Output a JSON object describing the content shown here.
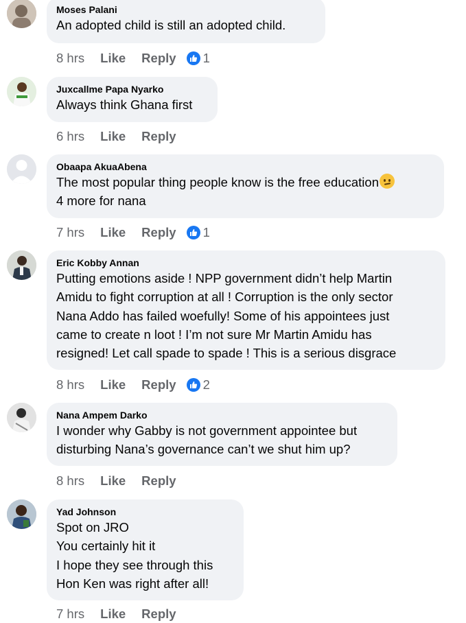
{
  "comments": [
    {
      "author": "Moses Palani",
      "text": "An adopted child is still an adopted child.",
      "time": "8 hrs",
      "like_label": "Like",
      "reply_label": "Reply",
      "reactions": "1",
      "avatar": "user-photo"
    },
    {
      "author": "Juxcallme Papa Nyarko",
      "text": "Always think Ghana first",
      "time": "6 hrs",
      "like_label": "Like",
      "reply_label": "Reply",
      "reactions": null,
      "avatar": "user-photo"
    },
    {
      "author": "Obaapa AkuaAbena",
      "text_line1": "The most popular thing people know is the free education",
      "text_line2": "4 more for nana",
      "emoji": "face-with-raised-eyebrow",
      "time": "7 hrs",
      "like_label": "Like",
      "reply_label": "Reply",
      "reactions": "1",
      "avatar": "default-silhouette"
    },
    {
      "author": "Eric Kobby Annan",
      "text": "Putting emotions aside ! NPP government didn’t help Martin\nAmidu to fight corruption at all ! Corruption is the only sector\nNana Addo has failed woefully! Some of his appointees just\ncame to create n loot ! I’m not sure Mr Martin Amidu has\nresigned! Let call spade to spade ! This is a serious disgrace",
      "time": "8 hrs",
      "like_label": "Like",
      "reply_label": "Reply",
      "reactions": "2",
      "avatar": "user-photo"
    },
    {
      "author": "Nana Ampem Darko",
      "text": "I wonder why Gabby is not government appointee but\ndisturbing Nana’s governance can’t we shut him up?",
      "time": "8 hrs",
      "like_label": "Like",
      "reply_label": "Reply",
      "reactions": null,
      "avatar": "user-photo"
    },
    {
      "author": "Yad Johnson",
      "text": "Spot on JRO\nYou certainly hit it\nI hope they see through this\nHon Ken was right after all!",
      "time": "7 hrs",
      "like_label": "Like",
      "reply_label": "Reply",
      "reactions": null,
      "avatar": "user-photo"
    }
  ],
  "colors": {
    "bubble": "#f0f2f5",
    "meta": "#65676b",
    "like_blue": "#1877f2"
  }
}
